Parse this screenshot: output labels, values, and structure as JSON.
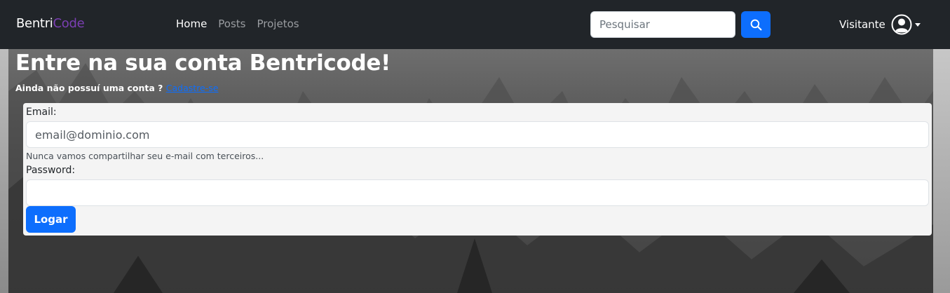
{
  "navbar": {
    "brand_part1": "Bentri",
    "brand_part2": "Code",
    "links": [
      {
        "label": "Home",
        "active": true
      },
      {
        "label": "Posts",
        "active": false
      },
      {
        "label": "Projetos",
        "active": false
      }
    ],
    "search": {
      "placeholder": "Pesquisar",
      "button_icon": "search-icon"
    },
    "user": {
      "label": "Visitante",
      "icon": "user-circle-icon",
      "dropdown_icon": "caret-down-icon"
    }
  },
  "main": {
    "title": "Entre na sua conta Bentricode!",
    "signup_prompt": "Ainda não possuí uma conta ? ",
    "signup_link": "Cadastre-se",
    "form": {
      "email_label": "Email:",
      "email_placeholder": "email@dominio.com",
      "email_help": "Nunca vamos compartilhar seu e-mail com terceiros...",
      "password_label": "Password:",
      "password_value": "",
      "submit_label": "Logar"
    }
  },
  "colors": {
    "navbar_bg": "#212529",
    "brand_accent": "#7b3fb3",
    "primary": "#0d6efd",
    "card_bg": "#f4f4f4"
  }
}
